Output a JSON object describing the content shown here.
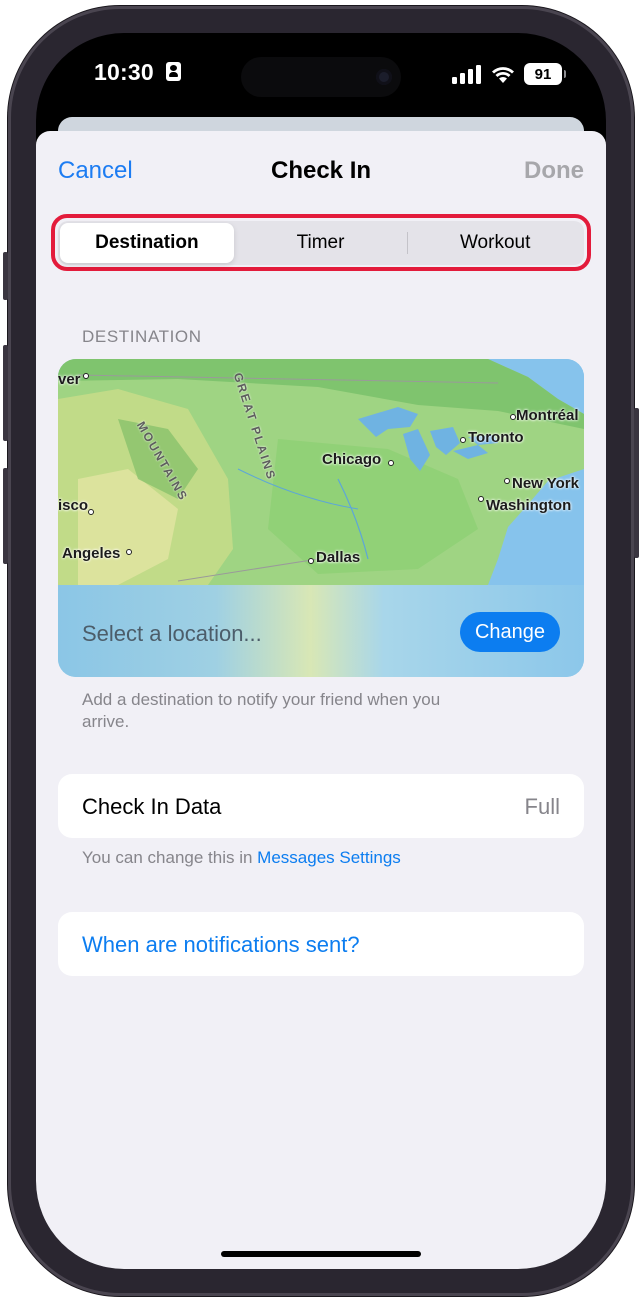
{
  "status_bar": {
    "time": "10:30",
    "battery": "91"
  },
  "nav": {
    "cancel_label": "Cancel",
    "title": "Check In",
    "done_label": "Done"
  },
  "segments": [
    {
      "label": "Destination",
      "selected": true
    },
    {
      "label": "Timer",
      "selected": false
    },
    {
      "label": "Workout",
      "selected": false
    }
  ],
  "destination": {
    "section_header": "DESTINATION",
    "map_labels": {
      "denver": "ver",
      "montreal": "Montréal",
      "toronto": "Toronto",
      "chicago": "Chicago",
      "new_york": "New York",
      "washington": "Washington",
      "san_francisco": "isco",
      "los_angeles": "Angeles",
      "dallas": "Dallas",
      "rocky_mountains": "MOUNTAINS",
      "great_plains": "GREAT PLAINS"
    },
    "location_placeholder": "Select a location...",
    "change_label": "Change",
    "footnote": "Add a destination to notify your friend when you arrive."
  },
  "check_in_data": {
    "label": "Check In Data",
    "value": "Full",
    "note_prefix": "You can change this in ",
    "note_link": "Messages Settings"
  },
  "notifications_link": "When are notifications sent?",
  "colors": {
    "accent": "#0c7df0",
    "highlight": "#e31b3b",
    "sheet_background": "#f1f0f6"
  }
}
